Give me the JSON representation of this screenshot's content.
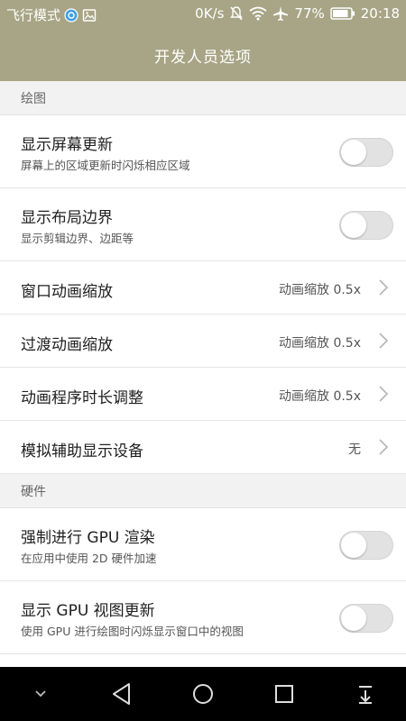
{
  "status_bar": {
    "airplane_text": "飞行模式",
    "speed": "0K/s",
    "battery": "77%",
    "time": "20:18"
  },
  "header": {
    "title": "开发人员选项"
  },
  "sections": [
    {
      "title": "绘图",
      "rows": [
        {
          "title": "显示屏幕更新",
          "subtitle": "屏幕上的区域更新时闪烁相应区域",
          "type": "toggle",
          "on": false
        },
        {
          "title": "显示布局边界",
          "subtitle": "显示剪辑边界、边距等",
          "type": "toggle",
          "on": false
        },
        {
          "title": "窗口动画缩放",
          "value": "动画缩放 0.5x",
          "type": "chevron"
        },
        {
          "title": "过渡动画缩放",
          "value": "动画缩放 0.5x",
          "type": "chevron"
        },
        {
          "title": "动画程序时长调整",
          "value": "动画缩放 0.5x",
          "type": "chevron"
        },
        {
          "title": "模拟辅助显示设备",
          "value": "无",
          "type": "chevron"
        }
      ]
    },
    {
      "title": "硬件",
      "rows": [
        {
          "title": "强制进行 GPU 渲染",
          "subtitle": "在应用中使用 2D 硬件加速",
          "type": "toggle",
          "on": false
        },
        {
          "title": "显示 GPU 视图更新",
          "subtitle": "使用 GPU 进行绘图时闪烁显示窗口中的视图",
          "type": "toggle",
          "on": false
        }
      ]
    }
  ],
  "icons": {
    "back": "back-triangle-icon",
    "home": "home-circle-icon",
    "recents": "recents-square-icon",
    "hide": "chevron-down-icon",
    "notifications": "pull-down-icon"
  },
  "colors": {
    "header": "#a7a585",
    "navbar": "#000000",
    "toggle_off": "#e2e2e2"
  }
}
